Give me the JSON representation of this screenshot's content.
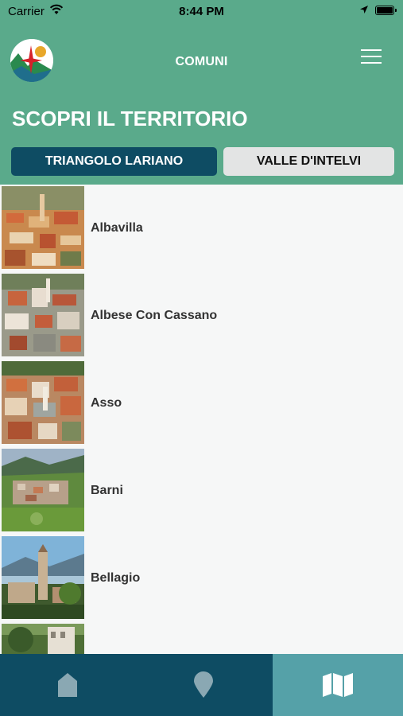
{
  "status_bar": {
    "carrier": "Carrier",
    "time": "8:44 PM"
  },
  "header": {
    "title": "COMUNI",
    "section_title": "SCOPRI IL TERRITORIO"
  },
  "tabs": [
    {
      "label": "TRIANGOLO LARIANO",
      "selected": true
    },
    {
      "label": "VALLE D'INTELVI",
      "selected": false
    }
  ],
  "comuni": [
    {
      "name": "Albavilla"
    },
    {
      "name": "Albese Con Cassano"
    },
    {
      "name": "Asso"
    },
    {
      "name": "Barni"
    },
    {
      "name": "Bellagio"
    },
    {
      "name": ""
    }
  ],
  "bottom_nav": [
    {
      "icon": "home-icon",
      "active": false
    },
    {
      "icon": "map-pin-icon",
      "active": false
    },
    {
      "icon": "map-icon",
      "active": true
    }
  ],
  "colors": {
    "header_bg": "#5aaa8b",
    "tab_active_bg": "#0e4c63",
    "tab_inactive_bg": "#e3e4e4",
    "bottom_nav_bg": "#0e4c63",
    "bottom_nav_active_bg": "#55a1a8"
  }
}
